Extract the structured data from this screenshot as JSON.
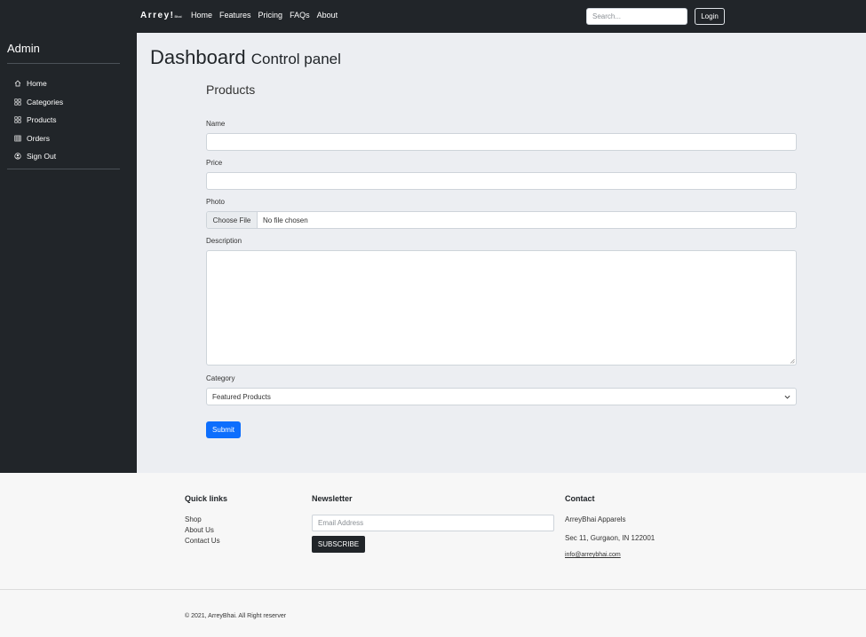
{
  "navbar": {
    "brand": "Arrey!",
    "brand_suffix": "Bhai",
    "links": [
      "Home",
      "Features",
      "Pricing",
      "FAQs",
      "About"
    ],
    "search_placeholder": "Search...",
    "login_label": "Login"
  },
  "sidebar": {
    "title": "Admin",
    "items": [
      {
        "label": "Home",
        "icon": "house-icon"
      },
      {
        "label": "Categories",
        "icon": "grid-icon"
      },
      {
        "label": "Products",
        "icon": "grid-icon"
      },
      {
        "label": "Orders",
        "icon": "table-icon"
      },
      {
        "label": "Sign Out",
        "icon": "user-circle-icon"
      }
    ]
  },
  "main": {
    "title": "Dashboard",
    "subtitle": "Control panel",
    "section_title": "Products",
    "form": {
      "name_label": "Name",
      "name_value": "",
      "price_label": "Price",
      "price_value": "",
      "photo_label": "Photo",
      "choose_file_label": "Choose File",
      "file_status": "No file chosen",
      "description_label": "Description",
      "description_value": "",
      "category_label": "Category",
      "category_selected": "Featured Products",
      "submit_label": "Submit"
    }
  },
  "footer": {
    "quick_links_title": "Quick links",
    "quick_links": [
      "Shop",
      "About Us",
      "Contact Us"
    ],
    "newsletter_title": "Newsletter",
    "email_placeholder": "Email Address",
    "subscribe_label": "SUBSCRIBE",
    "contact_title": "Contact",
    "company": "ArreyBhai Apparels",
    "address": "Sec 11, Gurgaon, IN 122001",
    "email": "info@arreybhai.com",
    "copyright": "© 2021, ArreyBhai. All Right reserver"
  },
  "colors": {
    "dark": "#212529",
    "accent": "#0d6efd",
    "main_bg": "#eceef2"
  }
}
